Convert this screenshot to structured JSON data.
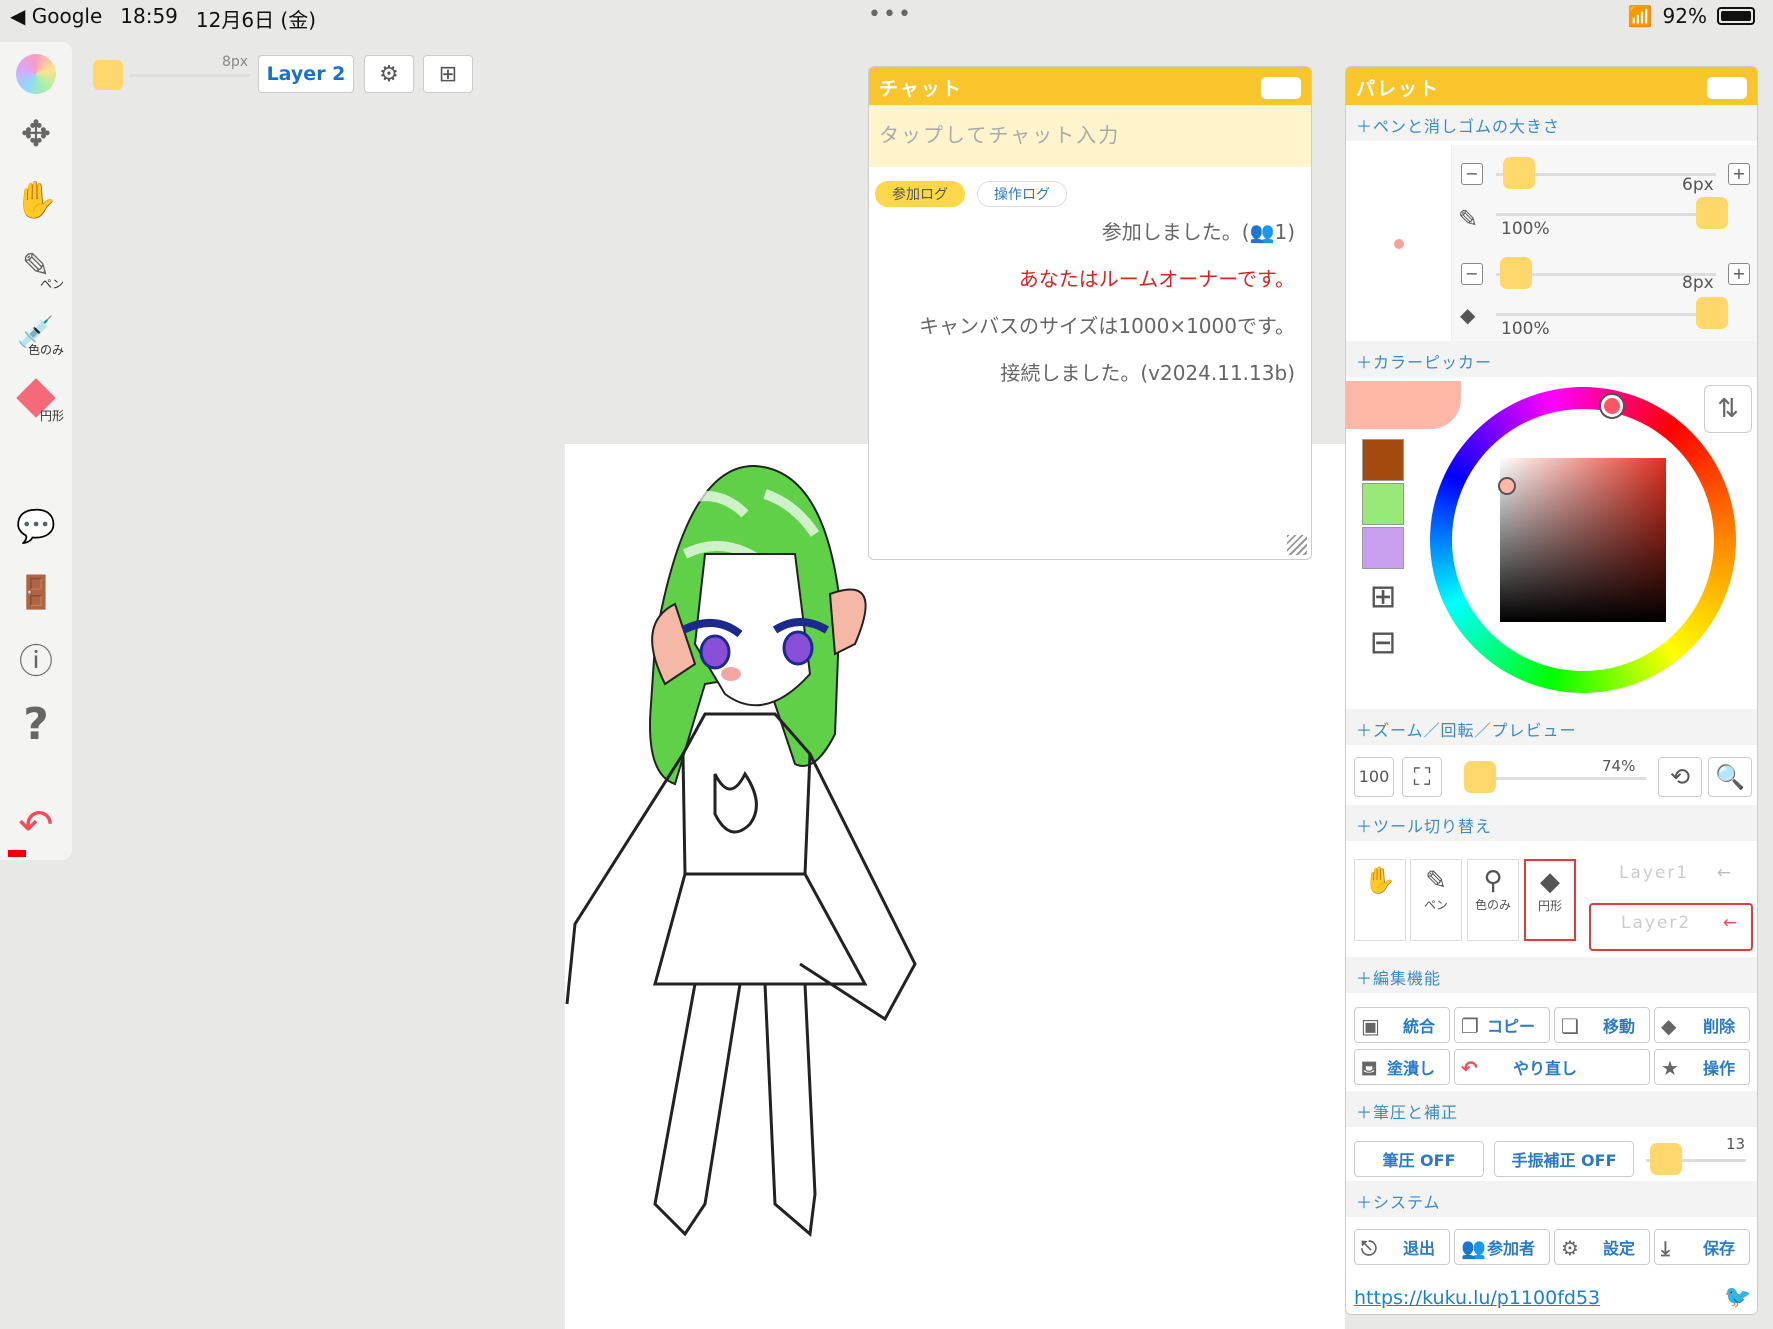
{
  "status": {
    "back_app": "◀ Google",
    "time": "18:59",
    "date": "12月6日 (金)",
    "battery": "92%"
  },
  "left_toolbar": {
    "items": [
      {
        "name": "pen",
        "label": "ペン"
      },
      {
        "name": "eyedropper",
        "label": "色のみ"
      },
      {
        "name": "eraser",
        "label": "円形"
      }
    ]
  },
  "top_toolbar": {
    "brush_size": "8px",
    "layer_label": "Layer 2"
  },
  "chat": {
    "title": "チャット",
    "input_placeholder": "タップしてチャット入力",
    "tab_join": "参加ログ",
    "tab_ops": "操作ログ",
    "messages": [
      "参加しました。(👥1)",
      "あなたはルームオーナーです。",
      "キャンバスのサイズは1000×1000です。",
      "接続しました。(v2024.11.13b)"
    ]
  },
  "palette": {
    "title": "パレット",
    "sections": {
      "pen_size": "＋ペンと消しゴムの大きさ",
      "color_picker": "＋カラーピッカー",
      "zoom": "＋ズーム／回転／プレビュー",
      "tool_switch": "＋ツール切り替え",
      "edit": "＋編集機能",
      "pressure": "＋筆圧と補正",
      "system": "＋システム"
    },
    "pen": {
      "size": "6px",
      "opacity": "100%"
    },
    "eraser": {
      "size": "8px",
      "opacity": "100%"
    },
    "zoom": {
      "reset_label": "100",
      "level": "74%"
    },
    "tool_cells": {
      "pen": "ペン",
      "eyedropper": "色のみ",
      "eraser": "円形"
    },
    "layers": [
      "Layer1",
      "Layer2"
    ],
    "edit_buttons": [
      "統合",
      "コピー",
      "移動",
      "削除",
      "塗潰し",
      "やり直し",
      "操作"
    ],
    "pressure_btn": "筆圧 OFF",
    "stabilizer_btn": "手振補正 OFF",
    "stabilizer_value": "13",
    "system_buttons": [
      "退出",
      "参加者",
      "設定",
      "保存"
    ],
    "room_url": "https://kuku.lu/p1100fd53"
  },
  "colors": {
    "accent": "#f8c52c",
    "knob": "#ffd76a",
    "current": "#ffb8a8",
    "swatch1": "#a34a0e",
    "swatch2": "#98e87a",
    "swatch3": "#c9a0ef"
  }
}
